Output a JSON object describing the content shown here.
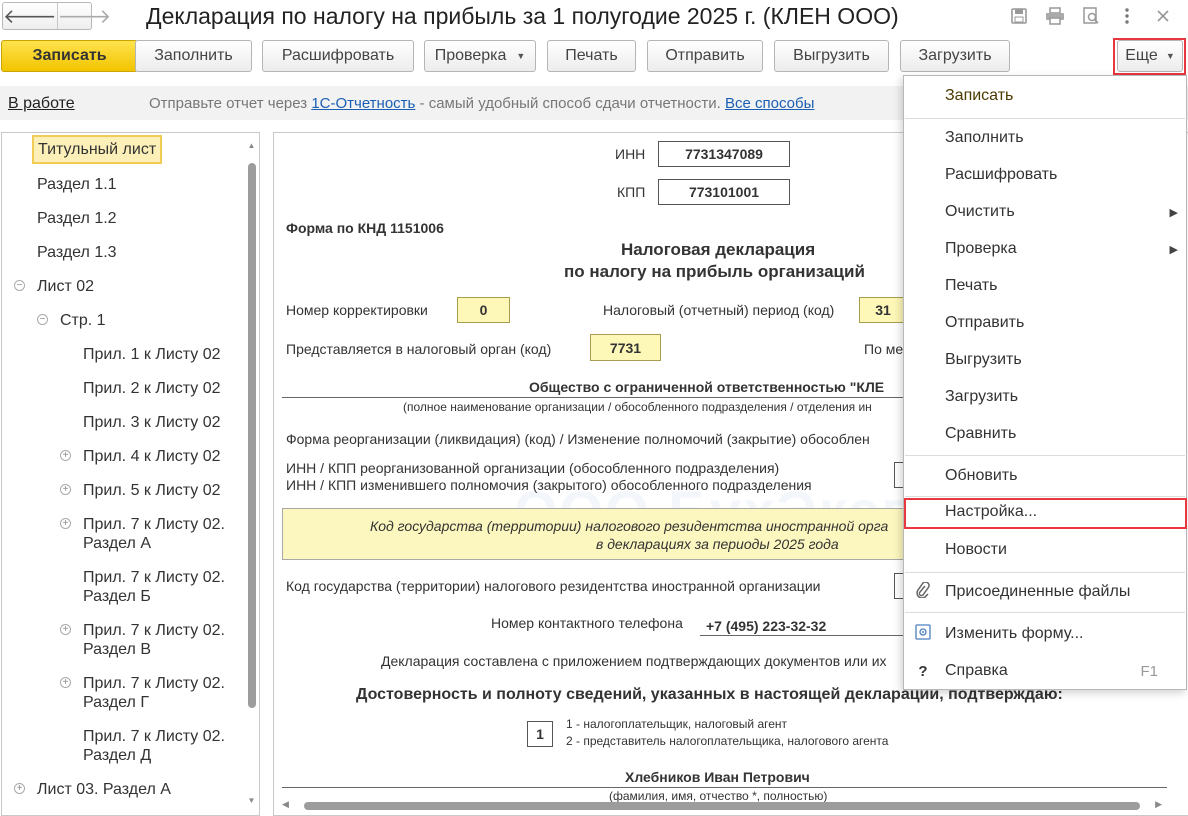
{
  "window": {
    "title": "Декларация по налогу на прибыль за 1 полугодие 2025 г. (КЛЕН ООО)",
    "nav_back": "🡐",
    "nav_forward": "🡒",
    "icons": [
      "save-icon",
      "print-icon",
      "preview-icon",
      "more-vertical-icon",
      "close-icon"
    ]
  },
  "toolbar": {
    "save": "Записать",
    "fill": "Заполнить",
    "decode": "Расшифровать",
    "check": "Проверка",
    "print": "Печать",
    "send": "Отправить",
    "export": "Выгрузить",
    "import": "Загрузить",
    "more": "Еще"
  },
  "infostrip": {
    "status": "В работе",
    "text_before": "Отправьте отчет через ",
    "link1": "1С-Отчетность",
    "text_after": " - самый удобный способ сдачи отчетности. ",
    "link2": "Все способы"
  },
  "tree": {
    "items": [
      "Титульный лист",
      "Раздел 1.1",
      "Раздел 1.2",
      "Раздел 1.3",
      "Лист 02",
      "Стр. 1",
      "Прил. 1 к Листу 02",
      "Прил. 2 к Листу 02",
      "Прил. 3 к Листу 02",
      "Прил. 4 к Листу 02",
      "Прил. 5 к Листу 02",
      "Прил. 7 к Листу 02. Раздел А",
      "Прил. 7 к Листу 02. Раздел Б",
      "Прил. 7 к Листу 02. Раздел В",
      "Прил. 7 к Листу 02. Раздел Г",
      "Прил. 7 к Листу 02. Раздел Д",
      "Лист 03. Раздел А"
    ]
  },
  "doc": {
    "inn_label": "ИНН",
    "inn_value": "7731347089",
    "kpp_label": "КПП",
    "kpp_value": "773101001",
    "form_code": "Форма по КНД 1151006",
    "heading1": "Налоговая декларация",
    "heading2": "по налогу на прибыль организаций",
    "correction_label": "Номер корректировки",
    "correction_value": "0",
    "period_label": "Налоговый (отчетный) период (код)",
    "period_value": "31",
    "authority_label": "Представляется в налоговый орган (код)",
    "authority_value": "7731",
    "location_label": "По ме",
    "org_name": "Общество с ограниченной ответственностью \"КЛЕ",
    "org_name_hint": "(полное наименование организации / обособленного подразделения / отделения ин",
    "reorg_label": "Форма реорганизации (ликвидация) (код) / Изменение полномочий (закрытие) обособлен",
    "reorg_inn_line1": "ИНН / КПП реорганизованной организации (обособленного подразделения)",
    "reorg_inn_line2": "ИНН / КПП изменившего полномочия (закрытого) обособленного подразделения",
    "band_line1": "Код государства (территории) налогового резидентства иностранной орга",
    "band_line2": "в декларациях за периоды 2025 года",
    "country_label": "Код государства (территории) налогового резидентства иностранной организации",
    "phone_label": "Номер контактного телефона",
    "phone_value": "+7 (495) 223-32-32",
    "appendix_text": "Декларация составлена с приложением подтверждающих документов или их",
    "confirm_heading": "Достоверность и полноту сведений, указанных в настоящей декларации, подтверждаю:",
    "signer_code": "1",
    "signer_opt1": "1 - налогоплательщик, налоговый агент",
    "signer_opt2": "2 - представитель налогоплательщика, налогового агента",
    "signer_name": "Хлебников Иван Петрович",
    "signer_hint": "(фамилия, имя, отчество *, полностью)"
  },
  "menu": {
    "items": {
      "save": "Записать",
      "fill": "Заполнить",
      "decode": "Расшифровать",
      "clear": "Очистить",
      "check": "Проверка",
      "print": "Печать",
      "send": "Отправить",
      "export": "Выгрузить",
      "import": "Загрузить",
      "compare": "Сравнить",
      "refresh": "Обновить",
      "settings": "Настройка...",
      "news": "Новости",
      "attachments": "Присоединенные файлы",
      "change_form": "Изменить форму...",
      "help": "Справка"
    },
    "help_shortcut": "F1"
  },
  "colors": {
    "primary_button": "#f2c500",
    "highlight_frame": "#e8373f",
    "link": "#1a5fb4",
    "selected_tree": "#fcf0b8",
    "input_yellow": "#fdf7b8"
  }
}
